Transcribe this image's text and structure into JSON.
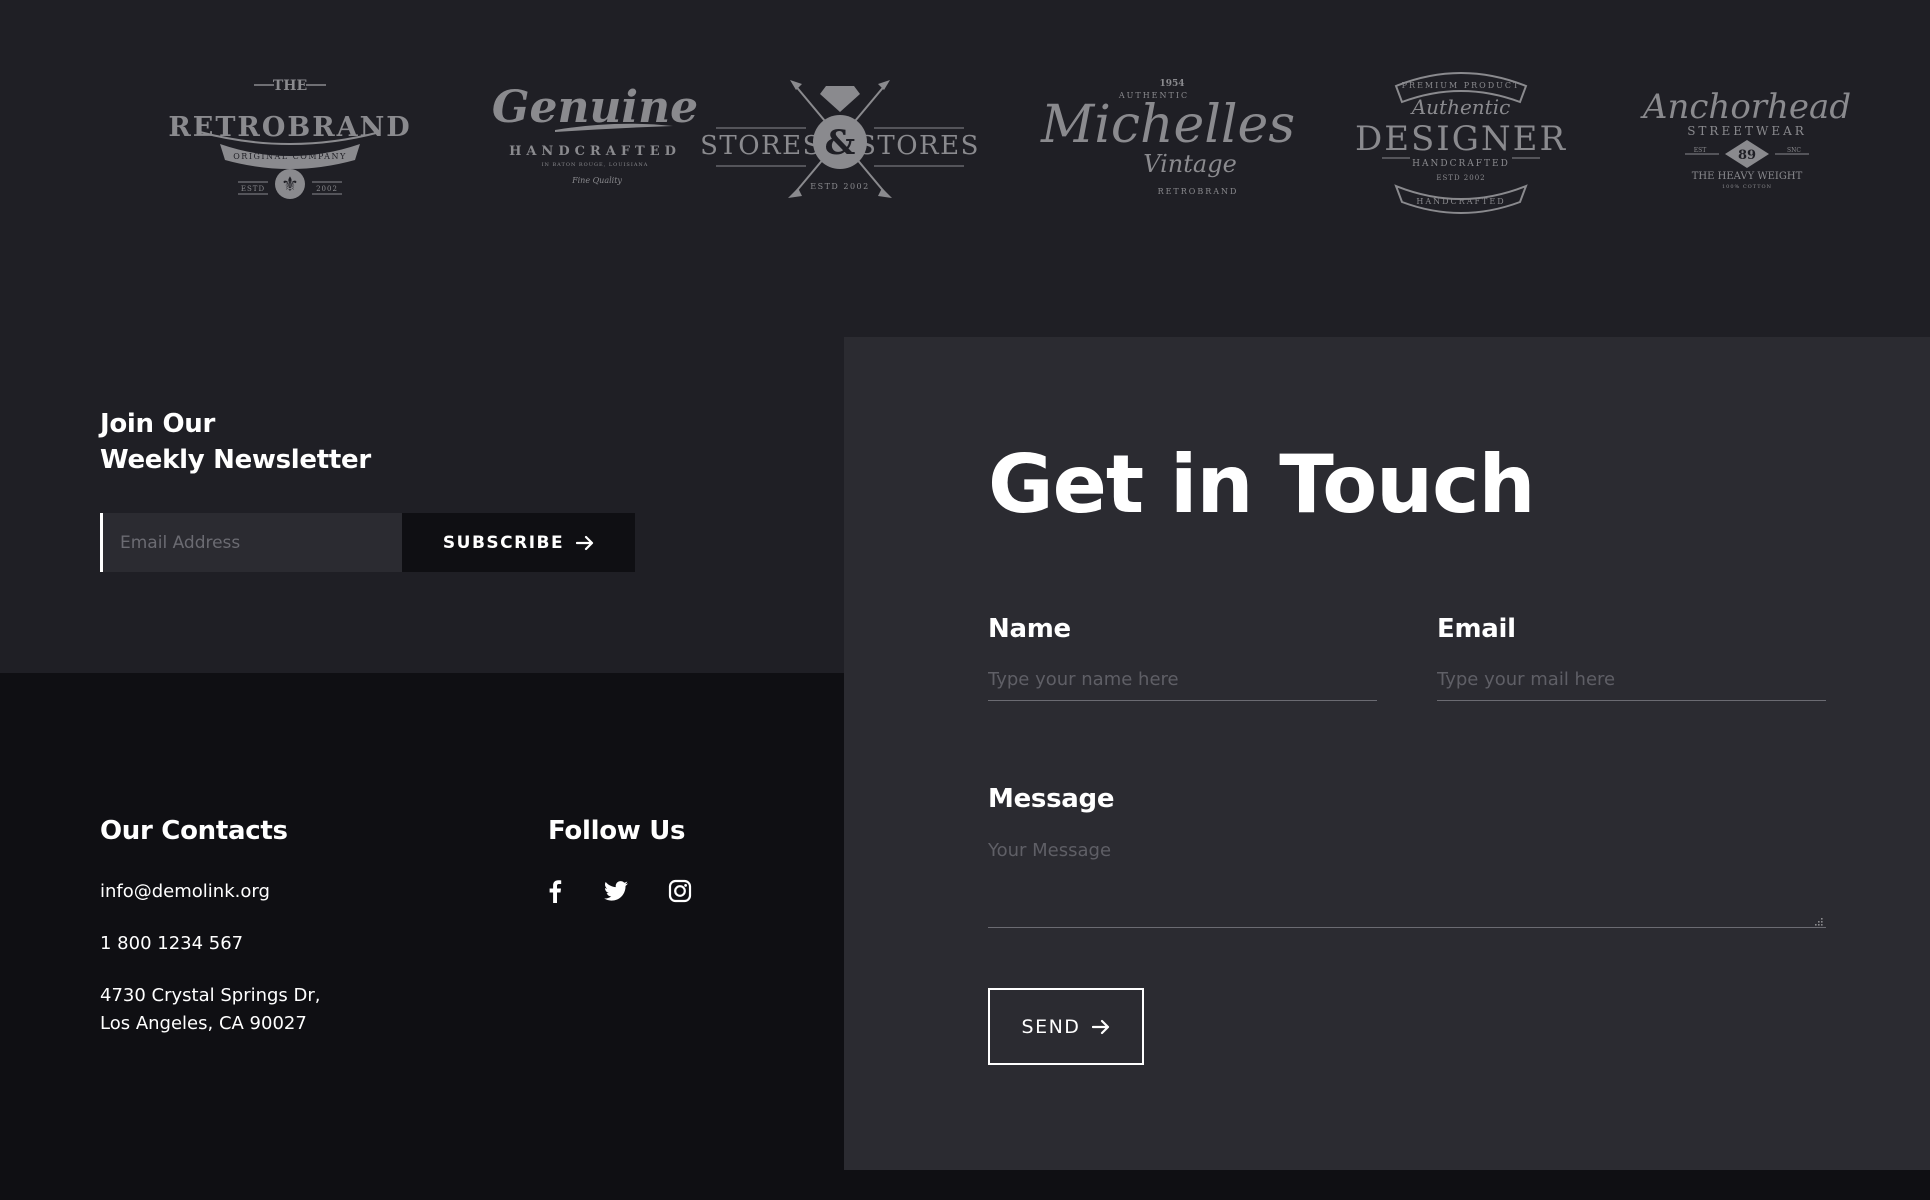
{
  "colors": {
    "page_bg_top": "#1f1f25",
    "page_bg_bottom": "#0f0f13",
    "panel_bg": "#2b2b31",
    "logo_gray": "#8a8a8e",
    "text": "#ffffff",
    "placeholder": "#6b6b72"
  },
  "brands": [
    {
      "name": "retrobrand",
      "lines": [
        "THE",
        "RETROBRAND",
        "ORIGINAL COMPANY",
        "ESTD",
        "2002"
      ]
    },
    {
      "name": "genuine",
      "lines": [
        "Genuine",
        "HANDCRAFTED",
        "IN BATON ROUGE, LOUISIANA",
        "Fine Quality"
      ]
    },
    {
      "name": "stores-and-stores",
      "lines": [
        "STORES",
        "&",
        "STORES",
        "ESTD 2002"
      ]
    },
    {
      "name": "michelles",
      "lines": [
        "1954",
        "AUTHENTIC",
        "Michelles",
        "Vintage",
        "RETROBRAND"
      ]
    },
    {
      "name": "designer",
      "lines": [
        "PREMIUM PRODUCT",
        "Authentic",
        "DESIGNER",
        "HANDCRAFTED",
        "ESTD 2002",
        "HANDCRAFTED"
      ]
    },
    {
      "name": "anchorhead",
      "lines": [
        "Anchorhead",
        "STREETWEAR",
        "EST",
        "89",
        "SNC",
        "THE HEAVY WEIGHT",
        "100% COTTON"
      ]
    }
  ],
  "newsletter": {
    "title_line1": "Join Our",
    "title_line2": "Weekly Newsletter",
    "email_placeholder": "Email Address",
    "subscribe_label": "SUBSCRIBE",
    "arrow_icon": "arrow-right-icon"
  },
  "contacts": {
    "title": "Our Contacts",
    "email": "info@demolink.org",
    "phone": "1 800 1234 567",
    "address_line1": "4730 Crystal Springs Dr,",
    "address_line2": "Los Angeles, CA 90027"
  },
  "follow": {
    "title": "Follow Us",
    "icons": [
      "facebook-icon",
      "twitter-icon",
      "instagram-icon"
    ]
  },
  "get_in_touch": {
    "title": "Get in Touch",
    "name_label": "Name",
    "name_placeholder": "Type your name here",
    "email_label": "Email",
    "email_placeholder": "Type your mail here",
    "message_label": "Message",
    "message_placeholder": "Your Message",
    "send_label": "SEND",
    "arrow_icon": "arrow-right-icon"
  }
}
